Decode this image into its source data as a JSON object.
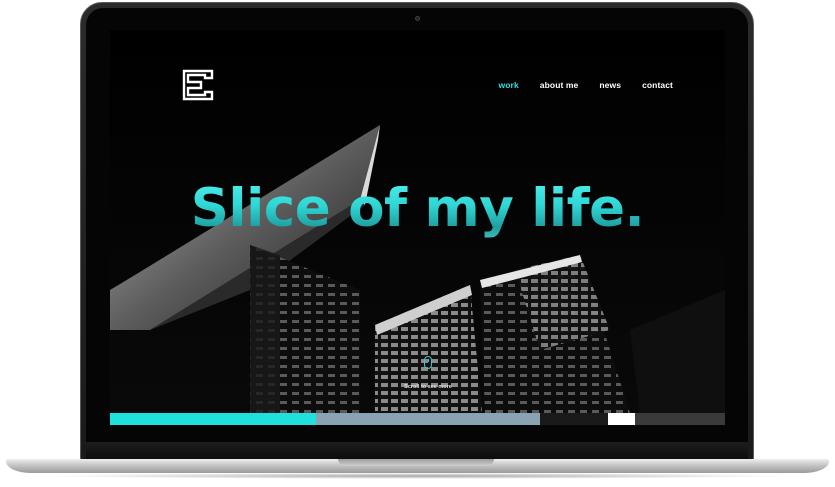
{
  "site": {
    "logo_icon": "letter-e-logo-icon",
    "nav": [
      {
        "label": "work",
        "active": true
      },
      {
        "label": "about me",
        "active": false
      },
      {
        "label": "news",
        "active": false
      },
      {
        "label": "contact",
        "active": false
      }
    ],
    "hero_title": "Slice of my life.",
    "scroll_hint": "Scroll to see more",
    "scroll_icon": "mouse-icon"
  },
  "colors": {
    "accent": "#2de0de",
    "strip": [
      "#1fe0dc",
      "#8aa3b2",
      "#1a1a1a",
      "#ffffff",
      "#3a3a3a"
    ]
  }
}
